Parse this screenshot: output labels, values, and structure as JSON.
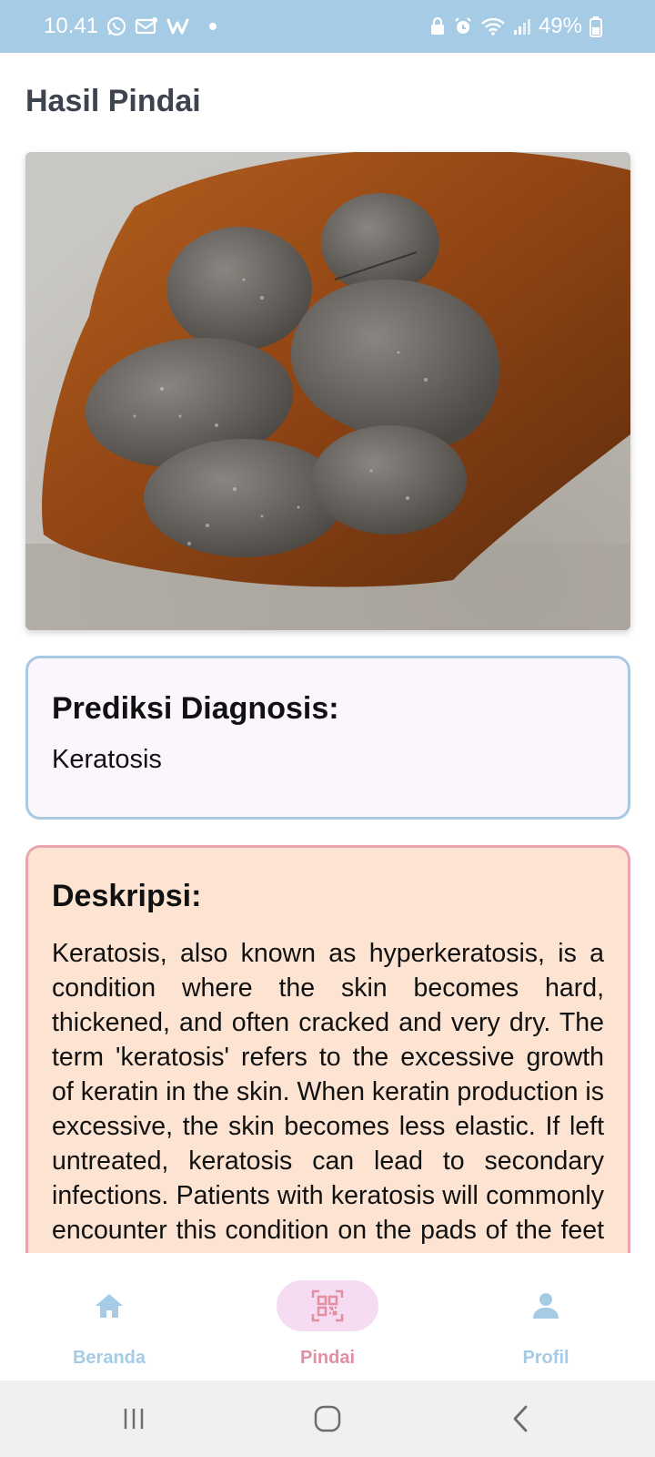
{
  "status_bar": {
    "time": "10.41",
    "battery": "49%",
    "left_icons": [
      "whatsapp-icon",
      "message-icon",
      "w-app-icon"
    ],
    "right_icons": [
      "lock-icon",
      "alarm-icon",
      "wifi-icon",
      "signal-icon",
      "battery-icon"
    ]
  },
  "page": {
    "title": "Hasil Pindai"
  },
  "scan": {
    "image_subject": "dog paw pads close-up"
  },
  "diagnosis": {
    "heading": "Prediksi Diagnosis:",
    "value": "Keratosis"
  },
  "description": {
    "heading": "Deskripsi:",
    "text": "Keratosis, also known as hyperkeratosis, is a condition where the skin becomes hard, thickened, and often cracked and very dry. The term 'keratosis' refers to the excessive growth of keratin in the skin. When keratin production is excessive, the skin becomes less elastic. If left untreated, keratosis can lead to secondary infections. Patients with keratosis will commonly encounter this condition on the pads of the feet or the nose."
  },
  "bottom_nav": {
    "items": [
      {
        "label": "Beranda",
        "icon": "home-icon",
        "active": false
      },
      {
        "label": "Pindai",
        "icon": "qr-scan-icon",
        "active": true
      },
      {
        "label": "Profil",
        "icon": "person-icon",
        "active": false
      }
    ]
  },
  "colors": {
    "status_bar": "#a6cbe5",
    "nav_inactive": "#a6cbe5",
    "nav_active": "#e48ea2",
    "nav_active_pill": "#f5dcf2",
    "diagnosis_border": "#a9c9e2",
    "description_bg": "#fde4d2",
    "description_border": "#e9a5b0"
  }
}
